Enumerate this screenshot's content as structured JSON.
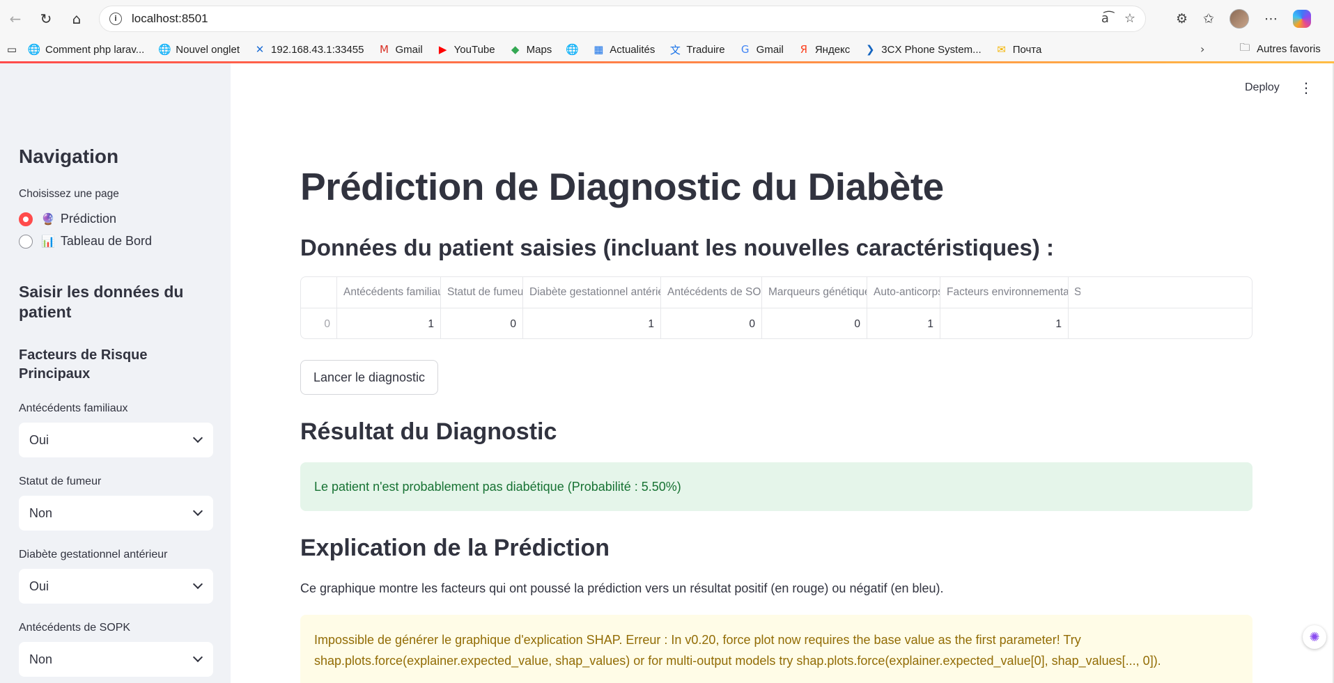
{
  "browser": {
    "url": "localhost:8501",
    "bookmarks": [
      {
        "label": "Comment php larav...",
        "icon": "globe-icon"
      },
      {
        "label": "Nouvel onglet",
        "icon": "globe-icon"
      },
      {
        "label": "192.168.43.1:33455",
        "icon": "x-logo-icon"
      },
      {
        "label": "Gmail",
        "icon": "gmail-icon"
      },
      {
        "label": "YouTube",
        "icon": "youtube-icon"
      },
      {
        "label": "Maps",
        "icon": "maps-pin-icon"
      },
      {
        "label": "",
        "icon": "globe-icon"
      },
      {
        "label": "Actualités",
        "icon": "news-icon"
      },
      {
        "label": "Traduire",
        "icon": "translate-icon"
      },
      {
        "label": "Gmail",
        "icon": "google-icon"
      },
      {
        "label": "Яндекс",
        "icon": "yandex-icon"
      },
      {
        "label": "3CX Phone System...",
        "icon": "3cx-icon"
      },
      {
        "label": "Почта",
        "icon": "mail-icon"
      }
    ],
    "other_favorites": "Autres favoris"
  },
  "sidebar": {
    "nav_title": "Navigation",
    "page_select_label": "Choisissez une page",
    "pages": [
      {
        "label": "Prédiction",
        "emoji": "🔮",
        "checked": true
      },
      {
        "label": "Tableau de Bord",
        "emoji": "📊",
        "checked": false
      }
    ],
    "input_title": "Saisir les données du patient",
    "risk_title": "Facteurs de Risque Principaux",
    "fields": [
      {
        "label": "Antécédents familiaux",
        "value": "Oui"
      },
      {
        "label": "Statut de fumeur",
        "value": "Non"
      },
      {
        "label": "Diabète gestationnel antérieur",
        "value": "Oui"
      },
      {
        "label": "Antécédents de SOPK",
        "value": "Non"
      }
    ]
  },
  "header": {
    "deploy": "Deploy",
    "menu": "⋮"
  },
  "main": {
    "title": "Prédiction de Diagnostic du Diabète",
    "data_title": "Données du patient saisies (incluant les nouvelles caractéristiques) :",
    "table": {
      "columns": [
        "",
        "Antécédents familiaux",
        "Statut de fumeur",
        "Diabète gestationnel antérieur",
        "Antécédents de SOPK",
        "Marqueurs génétiques",
        "Auto-anticorps",
        "Facteurs environnementaux",
        "S"
      ],
      "rows": [
        [
          "0",
          "1",
          "0",
          "1",
          "0",
          "0",
          "1",
          "1",
          ""
        ]
      ]
    },
    "run_button": "Lancer le diagnostic",
    "result_title": "Résultat du Diagnostic",
    "result_message": "Le patient n'est probablement pas diabétique (Probabilité : 5.50%)",
    "explain_title": "Explication de la Prédiction",
    "explain_text": "Ce graphique montre les facteurs qui ont poussé la prédiction vers un résultat positif (en rouge) ou négatif (en bleu).",
    "warning_line1": "Impossible de générer le graphique d'explication SHAP. Erreur : In v0.20, force plot now requires the base value as the first parameter! Try",
    "warning_line2": "shap.plots.force(explainer.expected_value, shap_values) or for multi-output models try shap.plots.force(explainer.expected_value[0], shap_values[..., 0])."
  },
  "colors": {
    "accent": "#ff4b4b",
    "success_bg": "#e5f5ea",
    "success_text": "#177233",
    "warning_bg": "#fffce7",
    "warning_text": "#926c05",
    "sidebar_bg": "#f0f2f6"
  }
}
